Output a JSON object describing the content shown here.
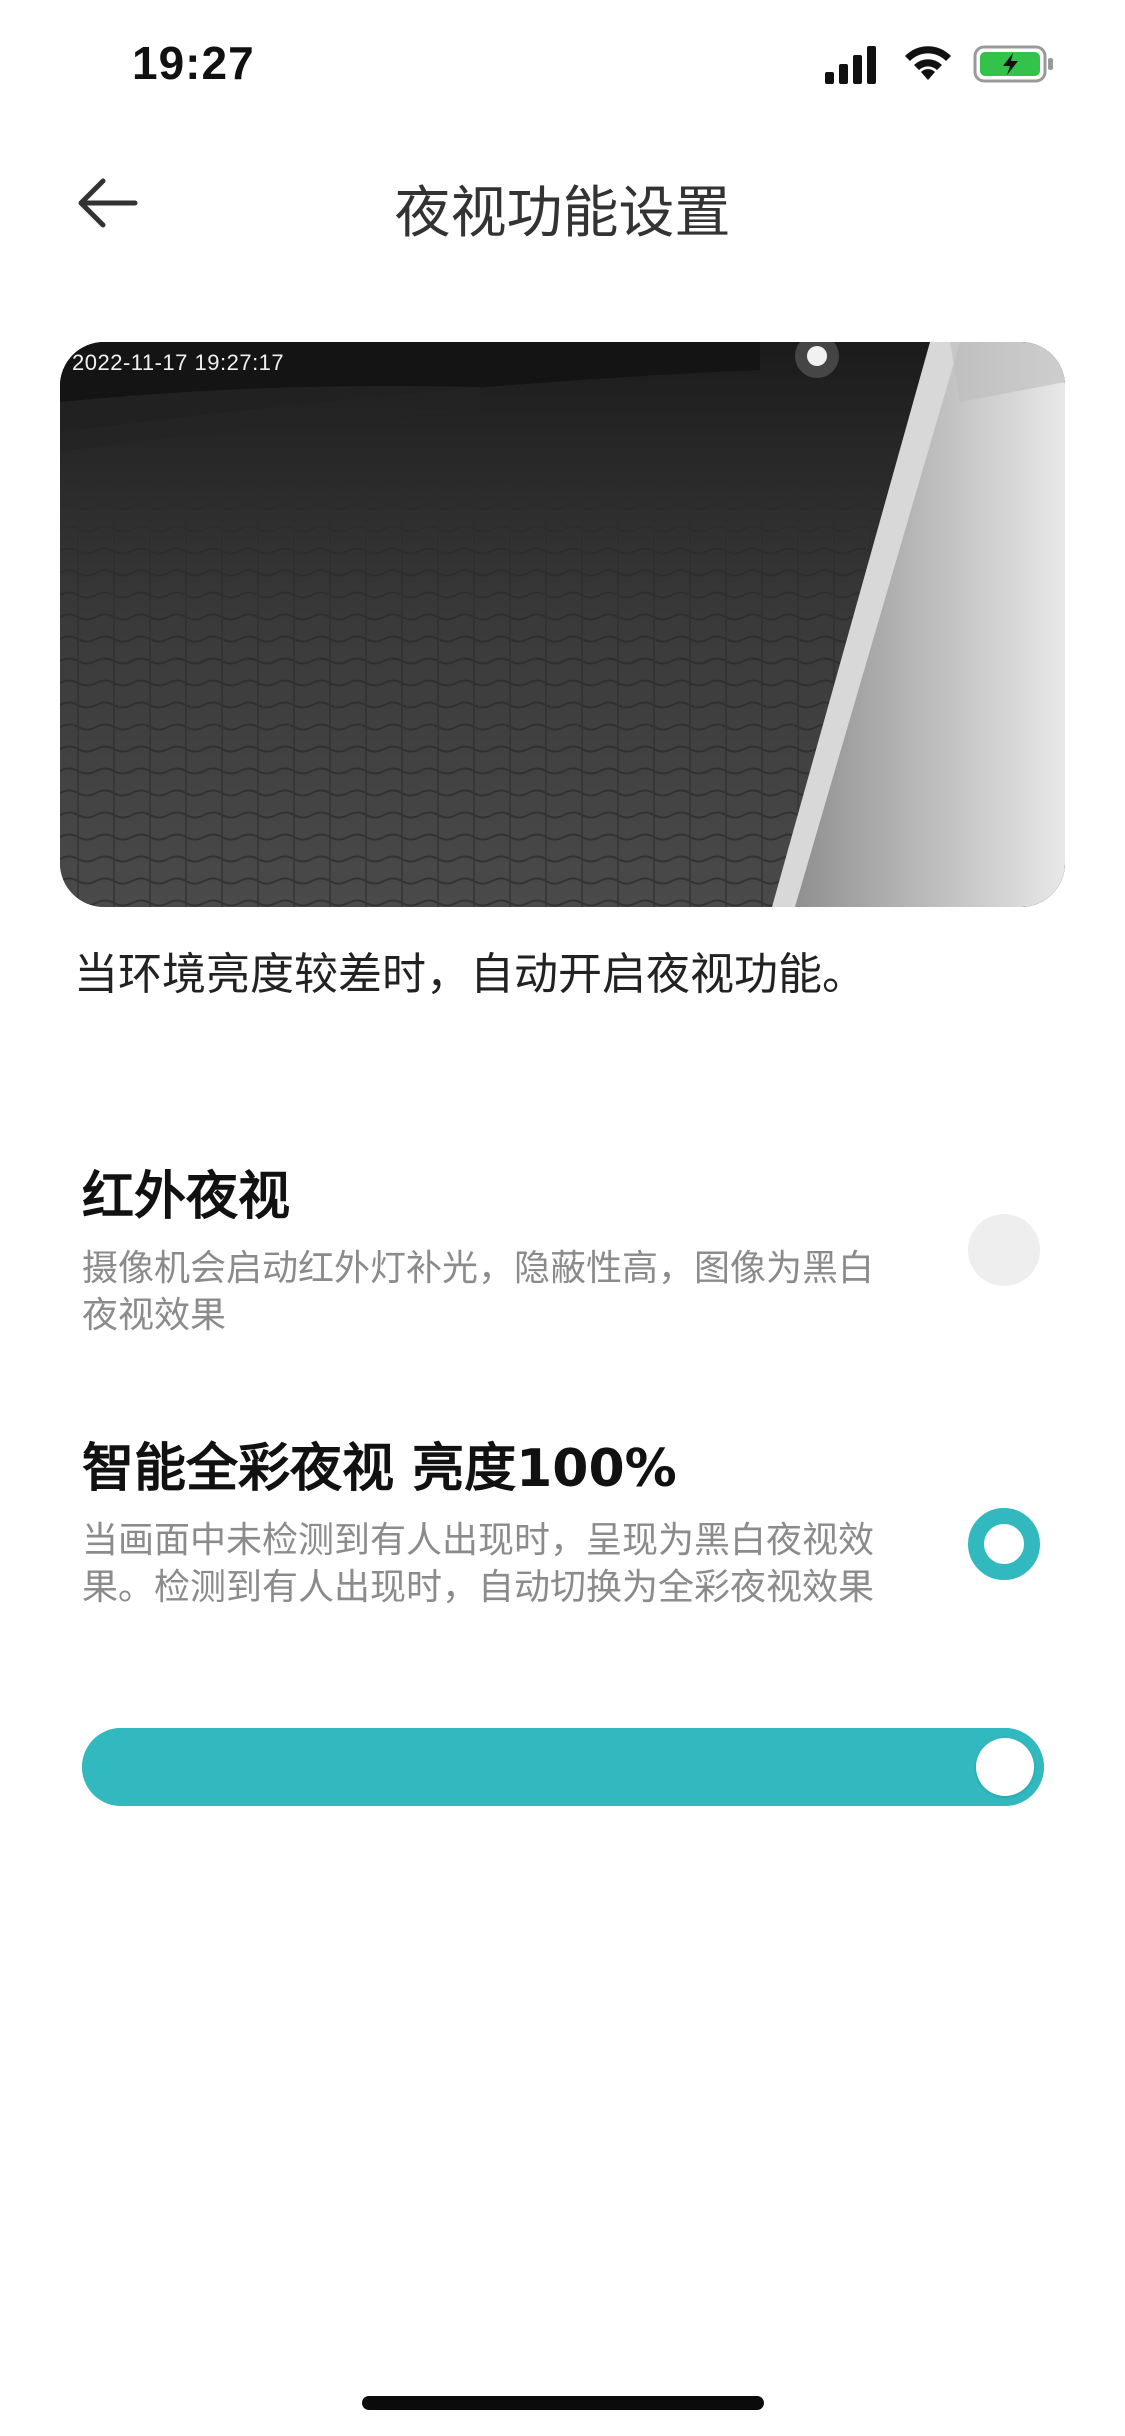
{
  "status_bar": {
    "time": "19:27",
    "icons": [
      "signal-icon",
      "wifi-icon",
      "battery-charging-icon"
    ],
    "battery_color": "#33c34b"
  },
  "header": {
    "title": "夜视功能设置",
    "back_icon": "back-arrow-icon"
  },
  "preview": {
    "timestamp": "2022-11-17 19:27:17"
  },
  "intro": "当环境亮度较差时，自动开启夜视功能。",
  "options": [
    {
      "title": "红外夜视",
      "description": "摄像机会启动红外灯补光，隐蔽性高，图像为黑白夜视效果",
      "selected": false
    },
    {
      "title": "智能全彩夜视 亮度100%",
      "description": "当画面中未检测到有人出现时，呈现为黑白夜视效果。检测到有人出现时，自动切换为全彩夜视效果",
      "selected": true
    }
  ],
  "brightness_slider": {
    "value_percent": 100
  },
  "colors": {
    "accent": "#31b9bf",
    "unselected_radio": "#eeeeee"
  }
}
